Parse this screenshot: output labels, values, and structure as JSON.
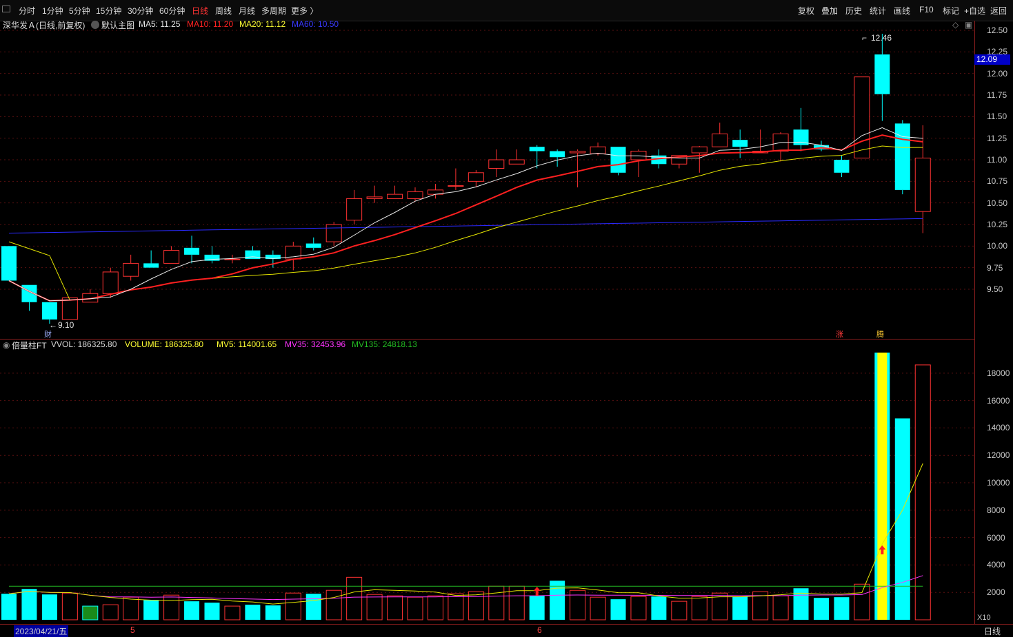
{
  "toolbar": {
    "periods": [
      "分时",
      "1分钟",
      "5分钟",
      "15分钟",
      "30分钟",
      "60分钟",
      "日线",
      "周线",
      "月线",
      "多周期",
      "更多 〉"
    ],
    "active_period": "日线",
    "right_buttons": [
      "复权",
      "叠加",
      "历史",
      "统计",
      "画线",
      "F10",
      "标记",
      "+自选",
      "返回"
    ]
  },
  "price_panel": {
    "stock_name": "深华发Ａ",
    "mode": "(日线,前复权)",
    "template": "默认主图",
    "ma": [
      {
        "label": "MA5: 11.25",
        "color": "#e6e6e6"
      },
      {
        "label": "MA10: 11.20",
        "color": "#ff2222"
      },
      {
        "label": "MA20: 11.12",
        "color": "#ffff33"
      },
      {
        "label": "MA60: 10.50",
        "color": "#3838ff"
      }
    ],
    "y_ticks": [
      "12.50",
      "12.25",
      "12.00",
      "11.75",
      "11.50",
      "11.25",
      "11.00",
      "10.75",
      "10.50",
      "10.25",
      "10.00",
      "9.75",
      "9.50"
    ],
    "current_price": "12.09",
    "high_label": "12.46",
    "low_label": "9.10",
    "markers": [
      "财",
      "涨",
      "腾"
    ]
  },
  "volume_panel": {
    "indicator": "倍量柱FT",
    "stats": [
      {
        "label": "VVOL: 186325.80",
        "color": "#d8d8d8"
      },
      {
        "label": "VOLUME: 186325.80",
        "color": "#ffff33"
      },
      {
        "label": "MV5: 114001.65",
        "color": "#ffff33"
      },
      {
        "label": "MV35: 32453.96",
        "color": "#ff33ff"
      },
      {
        "label": "MV135: 24818.13",
        "color": "#22bb22"
      }
    ],
    "y_ticks": [
      "18000",
      "16000",
      "14000",
      "12000",
      "10000",
      "8000",
      "6000",
      "4000",
      "2000"
    ],
    "unit": "X10"
  },
  "timeline": {
    "date": "2023/04/21/五",
    "month_marks": [
      "5",
      "6"
    ],
    "period_label": "日线"
  },
  "chart_data": {
    "type": "candlestick",
    "price_range": [
      9.35,
      12.6
    ],
    "volume_range": [
      0,
      19500
    ],
    "candles": [
      {
        "o": 10.0,
        "h": 10.0,
        "l": 9.6,
        "c": 9.6,
        "v": 1900
      },
      {
        "o": 9.55,
        "h": 9.55,
        "l": 9.25,
        "c": 9.35,
        "v": 2250
      },
      {
        "o": 9.35,
        "h": 9.35,
        "l": 9.1,
        "c": 9.15,
        "v": 1850
      },
      {
        "o": 9.15,
        "h": 9.4,
        "l": 9.15,
        "c": 9.4,
        "v": 1950
      },
      {
        "o": 9.35,
        "h": 9.5,
        "l": 9.35,
        "c": 9.45,
        "v": 1000
      },
      {
        "o": 9.45,
        "h": 9.75,
        "l": 9.4,
        "c": 9.7,
        "v": 1100
      },
      {
        "o": 9.65,
        "h": 9.9,
        "l": 9.6,
        "c": 9.8,
        "v": 1650
      },
      {
        "o": 9.8,
        "h": 9.95,
        "l": 9.75,
        "c": 9.75,
        "v": 1450
      },
      {
        "o": 9.8,
        "h": 10.0,
        "l": 9.8,
        "c": 9.95,
        "v": 1800
      },
      {
        "o": 9.98,
        "h": 10.12,
        "l": 9.8,
        "c": 9.9,
        "v": 1350
      },
      {
        "o": 9.9,
        "h": 10.0,
        "l": 9.8,
        "c": 9.83,
        "v": 1250
      },
      {
        "o": 9.85,
        "h": 9.9,
        "l": 9.8,
        "c": 9.85,
        "v": 1000
      },
      {
        "o": 9.95,
        "h": 10.0,
        "l": 9.85,
        "c": 9.85,
        "v": 1100
      },
      {
        "o": 9.9,
        "h": 9.95,
        "l": 9.75,
        "c": 9.85,
        "v": 1050
      },
      {
        "o": 9.85,
        "h": 10.05,
        "l": 9.72,
        "c": 10.0,
        "v": 1950
      },
      {
        "o": 10.03,
        "h": 10.1,
        "l": 9.95,
        "c": 9.98,
        "v": 1900
      },
      {
        "o": 10.05,
        "h": 10.28,
        "l": 10.0,
        "c": 10.25,
        "v": 2150
      },
      {
        "o": 10.3,
        "h": 10.65,
        "l": 10.25,
        "c": 10.55,
        "v": 3100
      },
      {
        "o": 10.55,
        "h": 10.7,
        "l": 10.5,
        "c": 10.57,
        "v": 1850
      },
      {
        "o": 10.55,
        "h": 10.7,
        "l": 10.55,
        "c": 10.6,
        "v": 1750
      },
      {
        "o": 10.55,
        "h": 10.68,
        "l": 10.52,
        "c": 10.63,
        "v": 1650
      },
      {
        "o": 10.6,
        "h": 10.72,
        "l": 10.55,
        "c": 10.65,
        "v": 1750
      },
      {
        "o": 10.7,
        "h": 10.9,
        "l": 10.65,
        "c": 10.7,
        "v": 1900
      },
      {
        "o": 10.75,
        "h": 10.88,
        "l": 10.68,
        "c": 10.85,
        "v": 2050
      },
      {
        "o": 10.9,
        "h": 11.12,
        "l": 10.8,
        "c": 11.0,
        "v": 2450
      },
      {
        "o": 10.95,
        "h": 11.12,
        "l": 10.95,
        "c": 11.0,
        "v": 2450
      },
      {
        "o": 11.15,
        "h": 11.17,
        "l": 10.9,
        "c": 11.1,
        "v": 1750
      },
      {
        "o": 11.1,
        "h": 11.12,
        "l": 10.92,
        "c": 11.03,
        "v": 2850
      },
      {
        "o": 11.08,
        "h": 11.12,
        "l": 10.68,
        "c": 11.1,
        "v": 2150
      },
      {
        "o": 11.07,
        "h": 11.2,
        "l": 11.05,
        "c": 11.15,
        "v": 1650
      },
      {
        "o": 11.15,
        "h": 11.15,
        "l": 10.82,
        "c": 10.85,
        "v": 1500
      },
      {
        "o": 11.0,
        "h": 11.12,
        "l": 10.8,
        "c": 11.1,
        "v": 1700
      },
      {
        "o": 11.05,
        "h": 11.12,
        "l": 10.9,
        "c": 10.95,
        "v": 1700
      },
      {
        "o": 10.95,
        "h": 11.05,
        "l": 10.9,
        "c": 11.05,
        "v": 1350
      },
      {
        "o": 11.08,
        "h": 11.16,
        "l": 10.85,
        "c": 11.15,
        "v": 1700
      },
      {
        "o": 11.15,
        "h": 11.43,
        "l": 11.15,
        "c": 11.3,
        "v": 1950
      },
      {
        "o": 11.23,
        "h": 11.35,
        "l": 11.02,
        "c": 11.15,
        "v": 1700
      },
      {
        "o": 11.08,
        "h": 11.35,
        "l": 11.08,
        "c": 11.1,
        "v": 2050
      },
      {
        "o": 11.1,
        "h": 11.32,
        "l": 10.98,
        "c": 11.3,
        "v": 1750
      },
      {
        "o": 11.35,
        "h": 11.6,
        "l": 11.1,
        "c": 11.17,
        "v": 2300
      },
      {
        "o": 11.17,
        "h": 11.22,
        "l": 11.1,
        "c": 11.12,
        "v": 1600
      },
      {
        "o": 11.0,
        "h": 11.05,
        "l": 10.8,
        "c": 10.85,
        "v": 1650
      },
      {
        "o": 11.02,
        "h": 11.96,
        "l": 11.02,
        "c": 11.96,
        "v": 2600
      },
      {
        "o": 12.22,
        "h": 12.46,
        "l": 11.45,
        "c": 11.76,
        "v": 19500
      },
      {
        "o": 11.42,
        "h": 11.46,
        "l": 10.6,
        "c": 10.65,
        "v": 14700
      },
      {
        "o": 10.4,
        "h": 11.4,
        "l": 10.15,
        "c": 11.02,
        "v": 18600
      }
    ],
    "special_volume_bars": [
      43
    ],
    "green_volume_bars": [
      4
    ]
  }
}
